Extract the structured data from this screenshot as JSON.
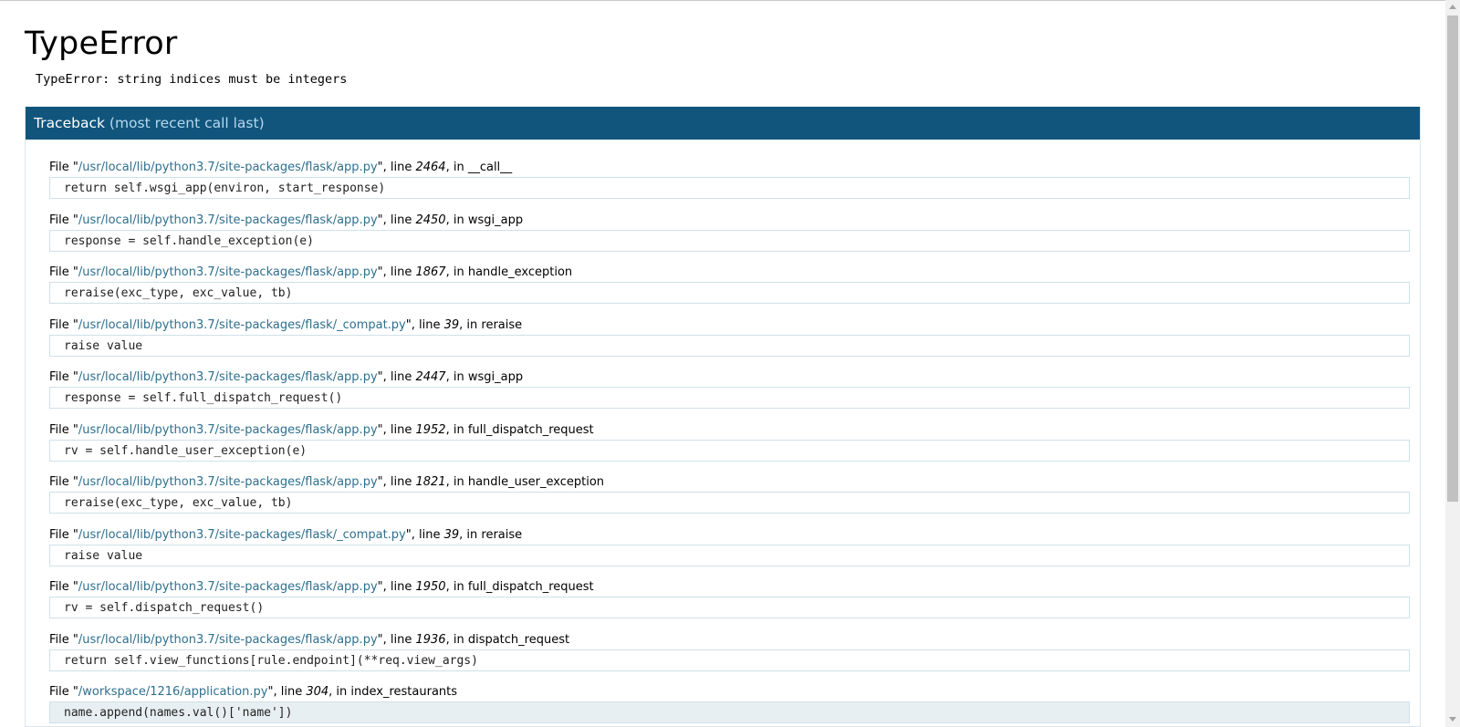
{
  "error": {
    "title": "TypeError",
    "message": "TypeError: string indices must be integers"
  },
  "traceback": {
    "label": "Traceback",
    "sub_label": "(most recent call last)",
    "frames": [
      {
        "path": "/usr/local/lib/python3.7/site-packages/flask/app.py",
        "line": "2464",
        "func": "__call__",
        "code": "return self.wsgi_app(environ, start_response)"
      },
      {
        "path": "/usr/local/lib/python3.7/site-packages/flask/app.py",
        "line": "2450",
        "func": "wsgi_app",
        "code": "response = self.handle_exception(e)"
      },
      {
        "path": "/usr/local/lib/python3.7/site-packages/flask/app.py",
        "line": "1867",
        "func": "handle_exception",
        "code": "reraise(exc_type, exc_value, tb)"
      },
      {
        "path": "/usr/local/lib/python3.7/site-packages/flask/_compat.py",
        "line": "39",
        "func": "reraise",
        "code": "raise value"
      },
      {
        "path": "/usr/local/lib/python3.7/site-packages/flask/app.py",
        "line": "2447",
        "func": "wsgi_app",
        "code": "response = self.full_dispatch_request()"
      },
      {
        "path": "/usr/local/lib/python3.7/site-packages/flask/app.py",
        "line": "1952",
        "func": "full_dispatch_request",
        "code": "rv = self.handle_user_exception(e)"
      },
      {
        "path": "/usr/local/lib/python3.7/site-packages/flask/app.py",
        "line": "1821",
        "func": "handle_user_exception",
        "code": "reraise(exc_type, exc_value, tb)"
      },
      {
        "path": "/usr/local/lib/python3.7/site-packages/flask/_compat.py",
        "line": "39",
        "func": "reraise",
        "code": "raise value"
      },
      {
        "path": "/usr/local/lib/python3.7/site-packages/flask/app.py",
        "line": "1950",
        "func": "full_dispatch_request",
        "code": "rv = self.dispatch_request()"
      },
      {
        "path": "/usr/local/lib/python3.7/site-packages/flask/app.py",
        "line": "1936",
        "func": "dispatch_request",
        "code": "return self.view_functions[rule.endpoint](**req.view_args)"
      },
      {
        "path": "/workspace/1216/application.py",
        "line": "304",
        "func": "index_restaurants",
        "code": "name.append(names.val()['name'])"
      }
    ]
  },
  "colors": {
    "header_bg": "#11557c",
    "path_color": "#2e6f8d",
    "code_border": "#cfe1e8"
  }
}
